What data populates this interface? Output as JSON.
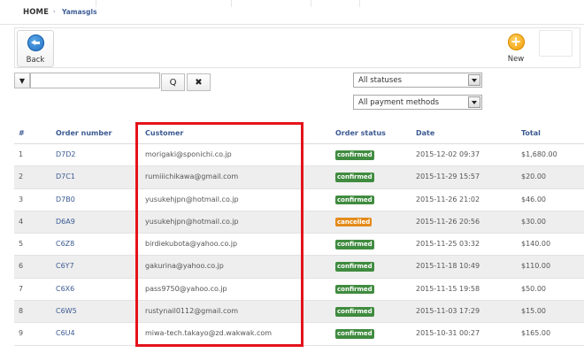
{
  "breadcrumb": {
    "home": "HOME",
    "separator": "›",
    "current": "Yamasgls"
  },
  "toolbar": {
    "back_label": "Back",
    "new_label": "New",
    "new_icon": "+"
  },
  "filters": {
    "search_value": "",
    "status_select": "All statuses",
    "payment_select": "All payment methods",
    "search_icon_glyph": "Q",
    "clear_icon_glyph": "✖",
    "filter_icon_glyph": "▼"
  },
  "table": {
    "headers": {
      "num": "#",
      "order_number": "Order number",
      "customer": "Customer",
      "status": "Order status",
      "date": "Date",
      "total": "Total"
    },
    "rows": [
      {
        "num": "1",
        "order": "D7D2",
        "customer": "morigaki@sponichi.co.jp",
        "status": "confirmed",
        "date": "2015-12-02 09:37",
        "total": "$1,680.00"
      },
      {
        "num": "2",
        "order": "D7C1",
        "customer": "rumiiichikawa@gmail.com",
        "status": "confirmed",
        "date": "2015-11-29 15:57",
        "total": "$20.00"
      },
      {
        "num": "3",
        "order": "D7B0",
        "customer": "yusukehjpn@hotmail.co.jp",
        "status": "confirmed",
        "date": "2015-11-26 21:02",
        "total": "$46.00"
      },
      {
        "num": "4",
        "order": "D6A9",
        "customer": "yusukehjpn@hotmail.co.jp",
        "status": "cancelled",
        "date": "2015-11-26 20:56",
        "total": "$30.00"
      },
      {
        "num": "5",
        "order": "C6Z8",
        "customer": "birdiekubota@yahoo.co.jp",
        "status": "confirmed",
        "date": "2015-11-25 03:32",
        "total": "$140.00"
      },
      {
        "num": "6",
        "order": "C6Y7",
        "customer": "gakurina@yahoo.co.jp",
        "status": "confirmed",
        "date": "2015-11-18 10:49",
        "total": "$110.00"
      },
      {
        "num": "7",
        "order": "C6X6",
        "customer": "pass9750@yahoo.co.jp",
        "status": "confirmed",
        "date": "2015-11-15 19:58",
        "total": "$50.00"
      },
      {
        "num": "8",
        "order": "C6W5",
        "customer": "rustynail0112@gmail.com",
        "status": "confirmed",
        "date": "2015-11-03 17:29",
        "total": "$15.00"
      },
      {
        "num": "9",
        "order": "C6U4",
        "customer": "miwa-tech.takayo@zd.wakwak.com",
        "status": "confirmed",
        "date": "2015-10-31 00:27",
        "total": "$165.00"
      }
    ]
  },
  "colors": {
    "highlight": "#e4131b",
    "confirmed": "#3f8b3f",
    "cancelled": "#e38b1a",
    "link": "#3b5a92"
  }
}
